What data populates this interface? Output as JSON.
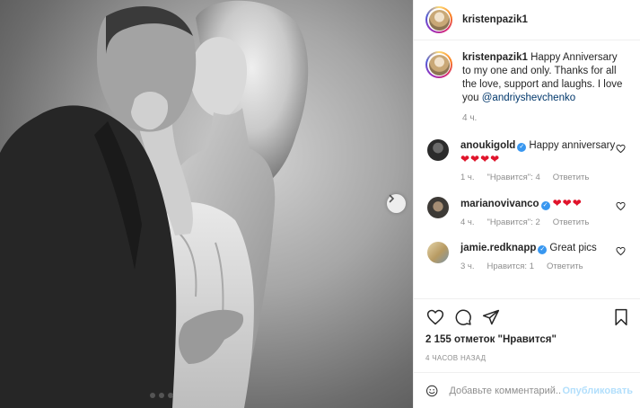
{
  "post": {
    "author": "kristenpazik1",
    "caption": {
      "username": "kristenpazik1",
      "text": "Happy Anniversary to my one and only. Thanks for all the love, support and laughs. I love you",
      "mention": "@andriyshevchenko",
      "time": "4 ч."
    },
    "comments": [
      {
        "username": "anoukigold",
        "verified": true,
        "text": "Happy anniversary",
        "hearts": "❤❤❤❤",
        "time": "1 ч.",
        "likes": "\"Нравится\": 4",
        "reply": "Ответить",
        "avatar_color": "#2b2b2b"
      },
      {
        "username": "marianovivanco",
        "verified": true,
        "text": "",
        "hearts": "❤❤❤",
        "time": "4 ч.",
        "likes": "\"Нравится\": 2",
        "reply": "Ответить",
        "avatar_color": "#3d3a36"
      },
      {
        "username": "jamie.redknapp",
        "verified": true,
        "text": "Great pics",
        "hearts": "",
        "time": "3 ч.",
        "likes": "Нравится: 1",
        "reply": "Ответить",
        "avatar_color": "#c8b184"
      }
    ],
    "likes_count": "2 155 отметок \"Нравится\"",
    "posted_ago": "4 ЧАСОВ НАЗАД",
    "comment_placeholder": "Добавьте комментарий...",
    "publish_label": "Опубликовать",
    "icons": {
      "like": "heart-icon",
      "comment": "comment-icon",
      "share": "share-icon",
      "save": "bookmark-icon",
      "emoji": "emoji-icon",
      "next": "chevron-right-icon"
    },
    "colors": {
      "link": "#00376b",
      "verified": "#3897f0",
      "heart": "#e0142b",
      "publish": "#b2dffc",
      "muted": "#8e8e8e"
    }
  }
}
